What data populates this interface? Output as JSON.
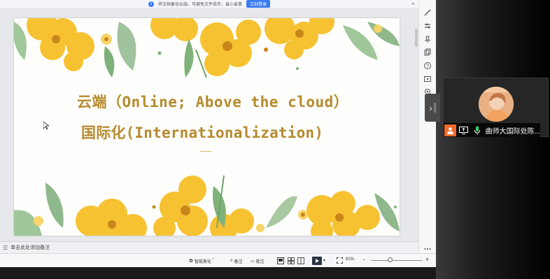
{
  "notice": {
    "text": "将文档备份云端，可避免文件丢失，省心省事",
    "login_label": "立刻登录",
    "close_glyph": "×"
  },
  "slide": {
    "title_line1": "云端（Online; Above the cloud）",
    "title_line2": "国际化(Internationalization)"
  },
  "notes": {
    "placeholder": "单击此处添加备注"
  },
  "status_bar": {
    "smart_beautify": "智能美化",
    "notes_label": "备注",
    "comments_label": "批注",
    "zoom": "81%",
    "zoom_minus": "-",
    "zoom_plus": "+"
  },
  "meeting": {
    "participant_name": "曲师大国际处陈..."
  },
  "colors": {
    "title_gold": "#b68a2e",
    "flower_yellow": "#f7c232",
    "leaf_green": "#7fb27a",
    "accent_blue": "#3b7cf0"
  }
}
